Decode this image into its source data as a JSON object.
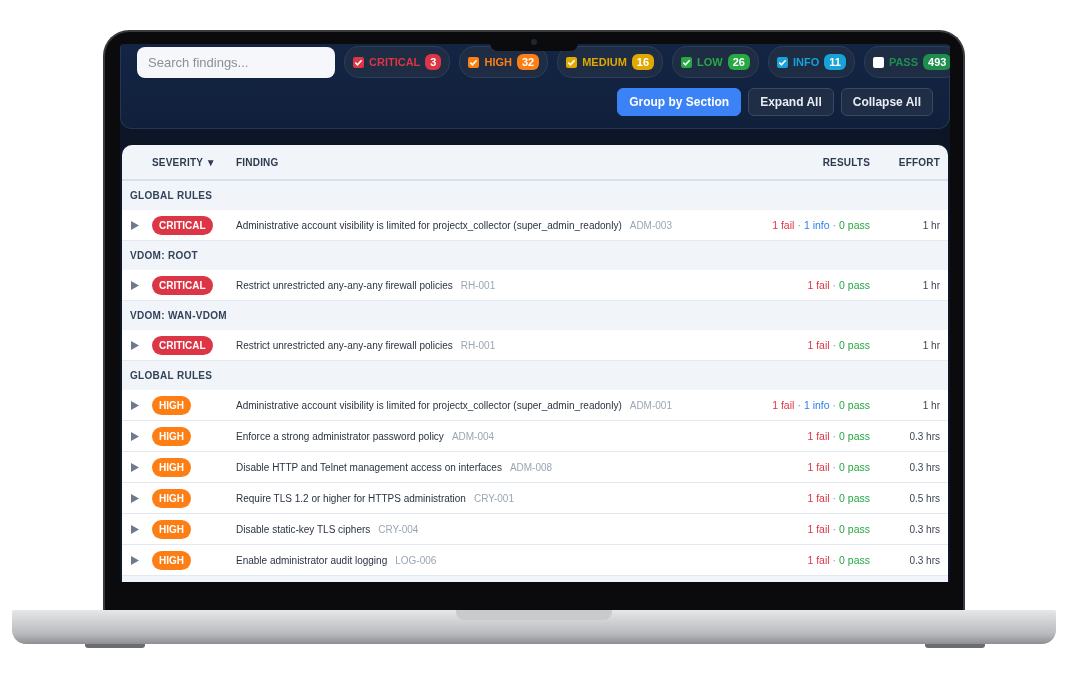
{
  "toolbar": {
    "search": {
      "placeholder": "Search findings..."
    },
    "filters": [
      {
        "label": "CRITICAL",
        "count": "3",
        "checked": true,
        "color": "#dc3545"
      },
      {
        "label": "HIGH",
        "count": "32",
        "checked": true,
        "color": "#fd7e14"
      },
      {
        "label": "MEDIUM",
        "count": "16",
        "checked": true,
        "color": "#e0a800"
      },
      {
        "label": "LOW",
        "count": "26",
        "checked": true,
        "color": "#28a745"
      },
      {
        "label": "INFO",
        "count": "11",
        "checked": true,
        "color": "#17a2d8"
      },
      {
        "label": "PASS",
        "count": "493",
        "checked": false,
        "color": "#1e8e4e"
      }
    ],
    "buttons": [
      {
        "label": "Group by Section",
        "selected": true
      },
      {
        "label": "Expand All",
        "selected": false
      },
      {
        "label": "Collapse All",
        "selected": false
      }
    ]
  },
  "table": {
    "columns": [
      {
        "label": "SEVERITY",
        "sort": "▼"
      },
      {
        "label": "FINDING"
      },
      {
        "label": "RESULTS"
      },
      {
        "label": "EFFORT"
      }
    ],
    "sections": [
      {
        "title": "GLOBAL RULES",
        "rows": [
          {
            "severity": "CRITICAL",
            "color": "#dc3545",
            "finding": "Administrative account visibility is limited for projectx_collector (super_admin_readonly)",
            "id": "ADM-003",
            "results": [
              {
                "kind": "fail",
                "text": "1 fail"
              },
              {
                "kind": "sep",
                "text": "·"
              },
              {
                "kind": "info",
                "text": "1 info"
              },
              {
                "kind": "sep",
                "text": "·"
              },
              {
                "kind": "pass",
                "text": "0 pass"
              }
            ],
            "effort": "1 hr"
          }
        ]
      },
      {
        "title": "VDOM: ROOT",
        "rows": [
          {
            "severity": "CRITICAL",
            "color": "#dc3545",
            "finding": "Restrict unrestricted any-any-any firewall policies",
            "id": "RH-001",
            "results": [
              {
                "kind": "fail",
                "text": "1 fail"
              },
              {
                "kind": "sep",
                "text": "·"
              },
              {
                "kind": "pass",
                "text": "0 pass"
              }
            ],
            "effort": "1 hr"
          }
        ]
      },
      {
        "title": "VDOM: WAN-VDOM",
        "rows": [
          {
            "severity": "CRITICAL",
            "color": "#dc3545",
            "finding": "Restrict unrestricted any-any-any firewall policies",
            "id": "RH-001",
            "results": [
              {
                "kind": "fail",
                "text": "1 fail"
              },
              {
                "kind": "sep",
                "text": "·"
              },
              {
                "kind": "pass",
                "text": "0 pass"
              }
            ],
            "effort": "1 hr"
          }
        ]
      },
      {
        "title": "GLOBAL RULES",
        "rows": [
          {
            "severity": "HIGH",
            "color": "#fd7e14",
            "finding": "Administrative account visibility is limited for projectx_collector (super_admin_readonly)",
            "id": "ADM-001",
            "results": [
              {
                "kind": "fail",
                "text": "1 fail"
              },
              {
                "kind": "sep",
                "text": "·"
              },
              {
                "kind": "info",
                "text": "1 info"
              },
              {
                "kind": "sep",
                "text": "·"
              },
              {
                "kind": "pass",
                "text": "0 pass"
              }
            ],
            "effort": "1 hr"
          },
          {
            "severity": "HIGH",
            "color": "#fd7e14",
            "finding": "Enforce a strong administrator password policy",
            "id": "ADM-004",
            "results": [
              {
                "kind": "fail",
                "text": "1 fail"
              },
              {
                "kind": "sep",
                "text": "·"
              },
              {
                "kind": "pass",
                "text": "0 pass"
              }
            ],
            "effort": "0.3 hrs"
          },
          {
            "severity": "HIGH",
            "color": "#fd7e14",
            "finding": "Disable HTTP and Telnet management access on interfaces",
            "id": "ADM-008",
            "results": [
              {
                "kind": "fail",
                "text": "1 fail"
              },
              {
                "kind": "sep",
                "text": "·"
              },
              {
                "kind": "pass",
                "text": "0 pass"
              }
            ],
            "effort": "0.3 hrs"
          },
          {
            "severity": "HIGH",
            "color": "#fd7e14",
            "finding": "Require TLS 1.2 or higher for HTTPS administration",
            "id": "CRY-001",
            "results": [
              {
                "kind": "fail",
                "text": "1 fail"
              },
              {
                "kind": "sep",
                "text": "·"
              },
              {
                "kind": "pass",
                "text": "0 pass"
              }
            ],
            "effort": "0.5 hrs"
          },
          {
            "severity": "HIGH",
            "color": "#fd7e14",
            "finding": "Disable static-key TLS ciphers",
            "id": "CRY-004",
            "results": [
              {
                "kind": "fail",
                "text": "1 fail"
              },
              {
                "kind": "sep",
                "text": "·"
              },
              {
                "kind": "pass",
                "text": "0 pass"
              }
            ],
            "effort": "0.3 hrs"
          },
          {
            "severity": "HIGH",
            "color": "#fd7e14",
            "finding": "Enable administrator audit logging",
            "id": "LOG-006",
            "results": [
              {
                "kind": "fail",
                "text": "1 fail"
              },
              {
                "kind": "sep",
                "text": "·"
              },
              {
                "kind": "pass",
                "text": "0 pass"
              }
            ],
            "effort": "0.3 hrs"
          }
        ]
      }
    ]
  }
}
